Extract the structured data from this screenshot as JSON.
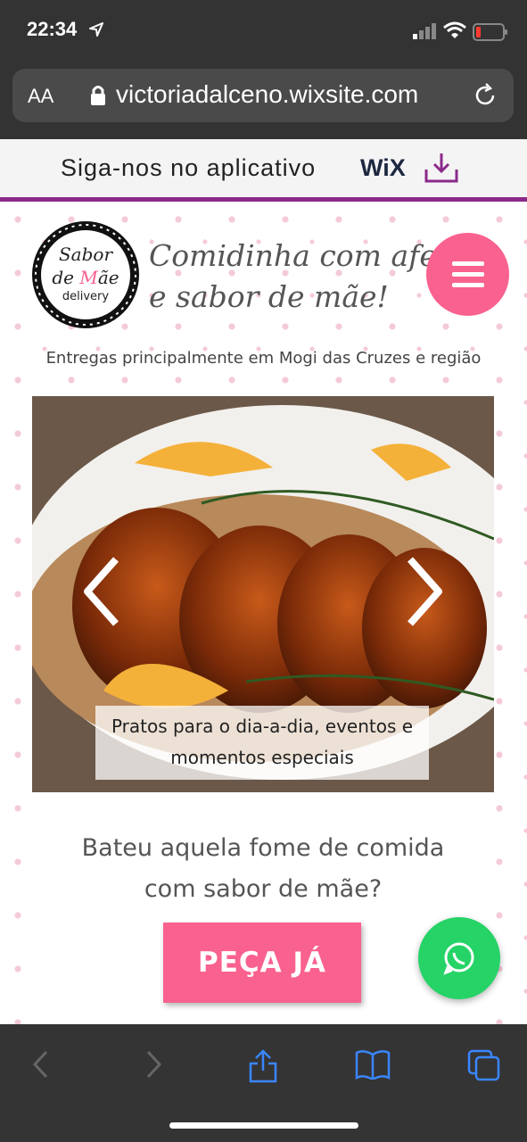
{
  "status_bar": {
    "time": "22:34"
  },
  "browser": {
    "text_size_label": "AA",
    "url": "victoriadalceno.wixsite.com"
  },
  "wix_banner": {
    "text": "Siga-nos no aplicativo",
    "brand": "WiX"
  },
  "header": {
    "logo": {
      "line1": "Sabor",
      "line2": "de Mãe",
      "line3": "delivery"
    },
    "tagline_line1": "Comidinha com afeto",
    "tagline_line2": "e sabor de mãe!",
    "delivery_area": "Entregas principalmente em Mogi das Cruzes e região"
  },
  "slideshow": {
    "caption_line1": "Pratos para o dia-a-dia, eventos e",
    "caption_line2": "momentos especiais"
  },
  "cta_section": {
    "question_line1": "Bateu aquela fome de comida",
    "question_line2": "com sabor de mãe?",
    "button_label": "PEÇA JÁ"
  },
  "colors": {
    "accent_pink": "#f9618f",
    "whatsapp_green": "#25d366",
    "wix_purple": "#8b2a8b"
  },
  "icons": [
    "location-arrow-icon",
    "signal-icon",
    "wifi-icon",
    "battery-icon",
    "lock-icon",
    "reload-icon",
    "download-icon",
    "menu-icon",
    "chevron-left-icon",
    "chevron-right-icon",
    "whatsapp-icon",
    "back-icon",
    "forward-icon",
    "share-icon",
    "bookmarks-icon",
    "tabs-icon"
  ]
}
